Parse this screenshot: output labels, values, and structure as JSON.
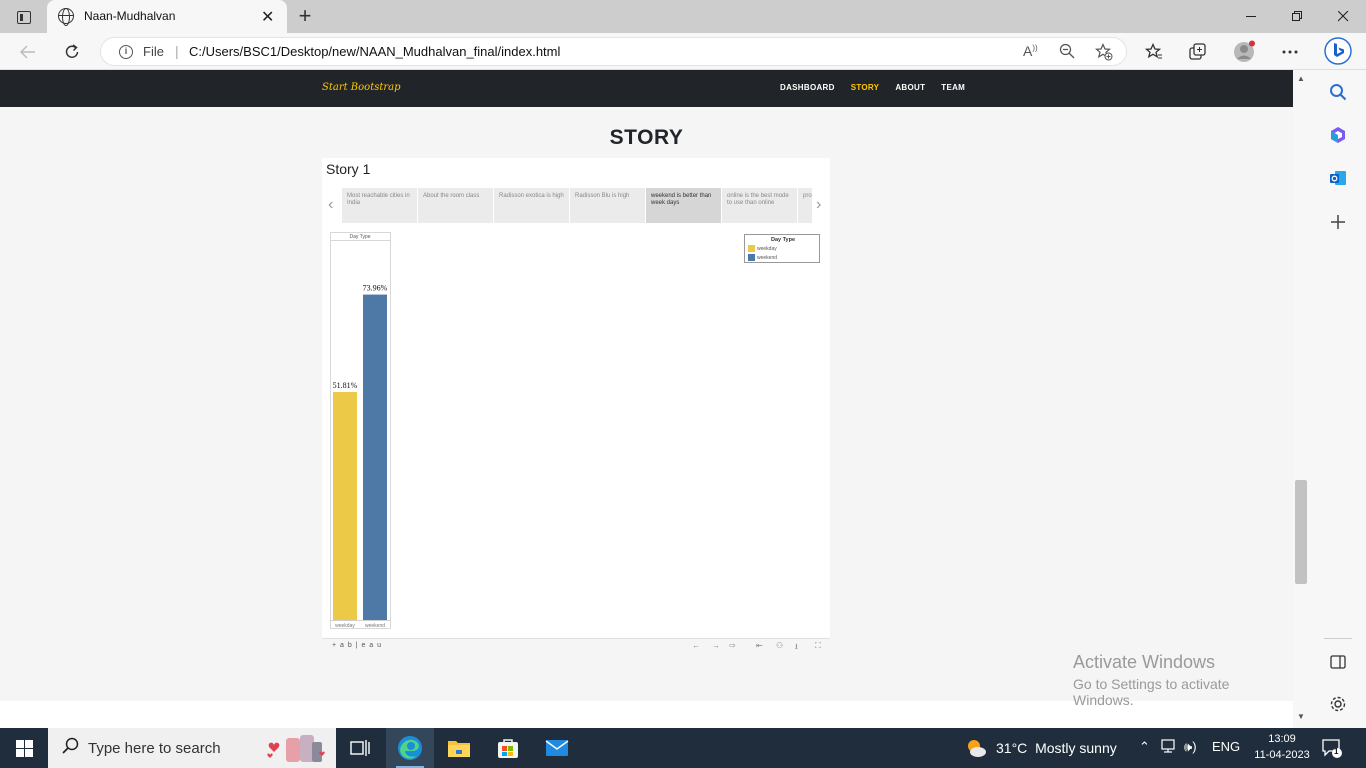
{
  "browser": {
    "tab_title": "Naan-Mudhalvan",
    "tab_close": "✕",
    "new_tab": "+",
    "address_protocol_label": "File",
    "address_url": "C:/Users/BSC1/Desktop/new/NAAN_Mudhalvan_final/index.html"
  },
  "page": {
    "brand": "Start Bootstrap",
    "nav": [
      "DASHBOARD",
      "STORY",
      "ABOUT",
      "TEAM"
    ],
    "active_nav": "STORY",
    "heading": "STORY"
  },
  "tableau": {
    "story_title": "Story 1",
    "story_points": [
      "Most reachable cities in India",
      "About the room class",
      "Radisson exotica is high",
      "Radisson Blu is high",
      "weekend is better than week days",
      "online is the best mode to use than online",
      "pro ma"
    ],
    "selected_point": 4,
    "footer_logo": "+ a b | e a u"
  },
  "chart_data": {
    "type": "bar",
    "title": "Day Type",
    "categories": [
      "weekday",
      "weekend"
    ],
    "values": [
      51.81,
      73.96
    ],
    "value_labels": [
      "51.81%",
      "73.96%"
    ],
    "ylim": [
      0,
      80
    ],
    "colors": [
      "#EDC948",
      "#4E79A7"
    ],
    "legend": {
      "title": "Day Type",
      "entries": [
        "weekday",
        "weekend"
      ],
      "placement": "top-right"
    },
    "grid": false
  },
  "watermark": {
    "line1": "Activate Windows",
    "line2": "Go to Settings to activate Windows."
  },
  "taskbar": {
    "search_placeholder": "Type here to search",
    "temperature": "31°C",
    "weather": "Mostly sunny",
    "language": "ENG",
    "time": "13:09",
    "date": "11-04-2023",
    "notification_count": "1"
  }
}
